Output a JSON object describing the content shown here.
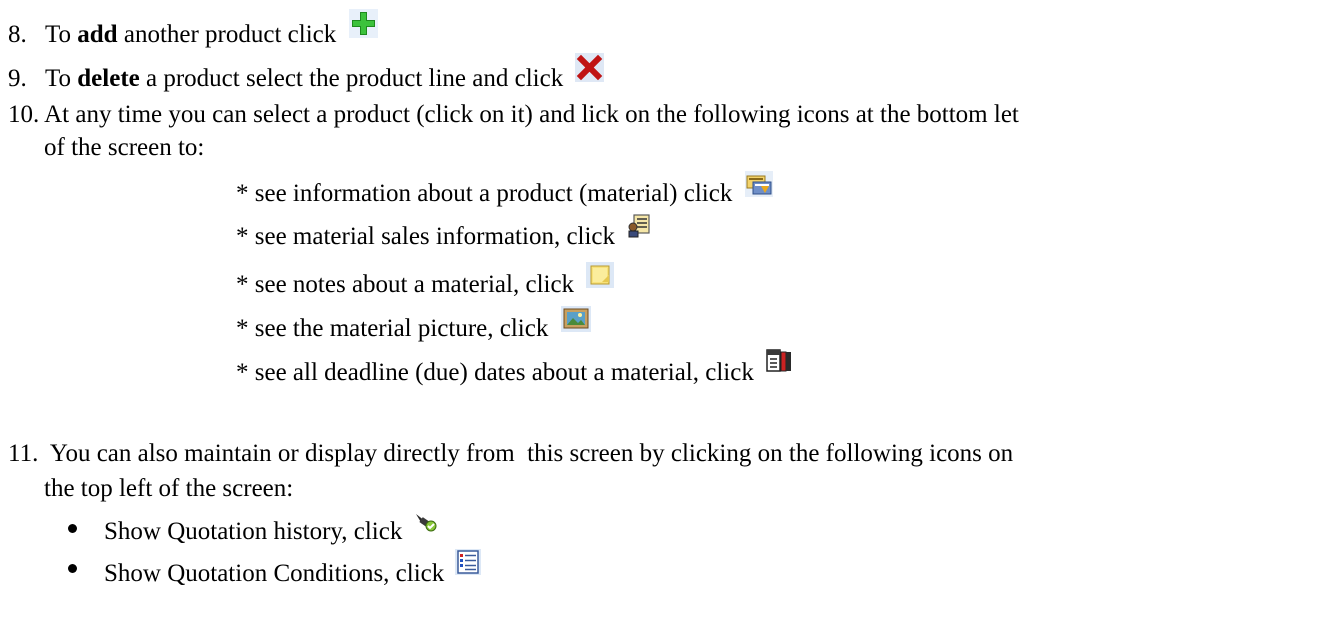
{
  "items": {
    "item8": {
      "number": "8.",
      "pre": "To ",
      "bold": "add",
      "post": " another product click",
      "icon": "add-green-plus-icon"
    },
    "item9": {
      "number": "9.",
      "pre": "To ",
      "bold": "delete",
      "post": " a product select the product line and click",
      "icon": "delete-red-x-icon"
    },
    "item10": {
      "number": "10.",
      "line1": "At any time you can select a product (click on it) and lick on the following icons at the bottom let",
      "line2": "of the screen to:",
      "subs": [
        {
          "text": "* see information about a product (material) click",
          "icon": "material-info-icon"
        },
        {
          "text": "* see material sales information, click",
          "icon": "sales-info-icon"
        },
        {
          "text": "* see notes about a material, click",
          "icon": "notes-icon"
        },
        {
          "text": "* see the material picture, click",
          "icon": "picture-icon"
        },
        {
          "text": "* see all deadline (due) dates about a material, click",
          "icon": "deadline-dates-icon"
        }
      ]
    },
    "item11": {
      "number": "11.",
      "line1": " You can also maintain or display directly from  this screen by clicking on the following icons on",
      "line2": "the top left of the screen:",
      "bullets": [
        {
          "text": "Show Quotation history, click",
          "icon": "quotation-history-icon"
        },
        {
          "text": "Show Quotation Conditions, click",
          "icon": "quotation-conditions-icon"
        }
      ]
    }
  },
  "colors": {
    "text": "#000000",
    "plus_green": "#2fa02f",
    "delete_red": "#d01818"
  }
}
